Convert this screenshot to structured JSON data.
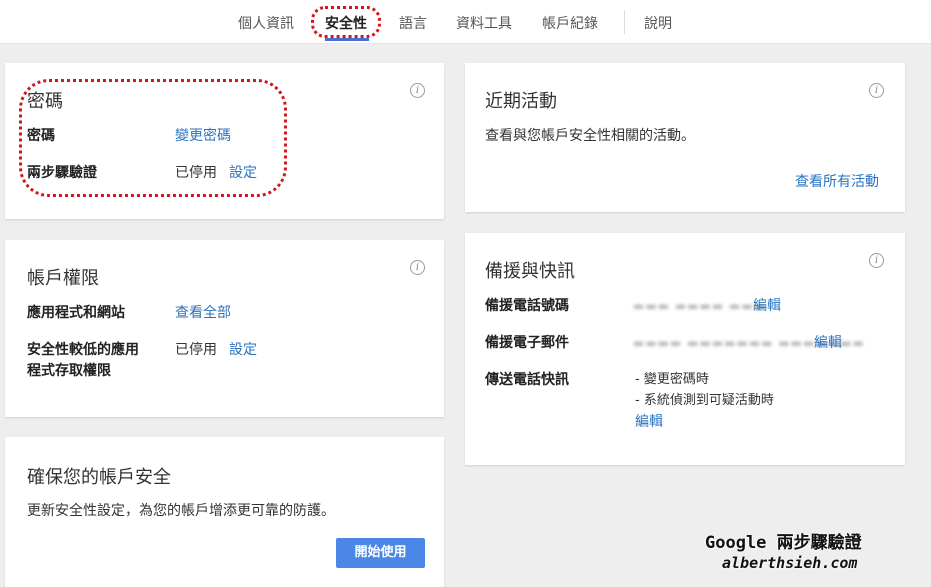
{
  "nav": {
    "tabs": [
      {
        "label": "個人資訊"
      },
      {
        "label": "安全性",
        "active": true
      },
      {
        "label": "語言"
      },
      {
        "label": "資料工具"
      },
      {
        "label": "帳戶紀錄"
      },
      {
        "label": "說明"
      }
    ],
    "accent_color": "#4a6fd2"
  },
  "password_card": {
    "title": "密碼",
    "rows": [
      {
        "label": "密碼",
        "link": "變更密碼"
      },
      {
        "label": "兩步驟驗證",
        "status": "已停用",
        "link": "設定"
      }
    ]
  },
  "recent_activity_card": {
    "title": "近期活動",
    "description": "查看與您帳戶安全性相關的活動。",
    "link": "查看所有活動"
  },
  "account_permissions_card": {
    "title": "帳戶權限",
    "rows": [
      {
        "label": "應用程式和網站",
        "link": "查看全部"
      },
      {
        "label_line1": "安全性較低的應用",
        "label_line2": "程式存取權限",
        "status": "已停用",
        "link": "設定"
      }
    ]
  },
  "recovery_card": {
    "title": "備援與快訊",
    "rows": [
      {
        "label": "備援電話號碼",
        "link": "編輯"
      },
      {
        "label": "備援電子郵件",
        "link": "編輯"
      },
      {
        "label": "傳送電話快訊",
        "items": [
          "- 變更密碼時",
          "- 系統偵測到可疑活動時"
        ],
        "link": "編輯"
      }
    ]
  },
  "secure_card": {
    "title": "確保您的帳戶安全",
    "description": "更新安全性設定，為您的帳戶增添更可靠的防護。",
    "button": "開始使用",
    "button_color": "#4a87e6"
  },
  "watermark": {
    "line1": "Google 兩步驟驗證",
    "line2": "alberthsieh.com"
  },
  "annotation_color": "#d4151b",
  "link_color": "#2a73c0"
}
